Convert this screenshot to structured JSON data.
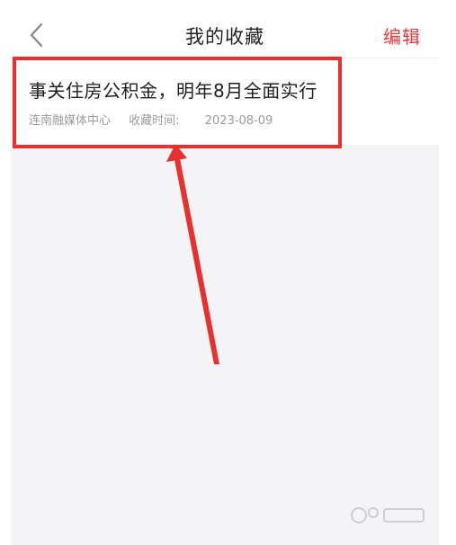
{
  "nav": {
    "title": "我的收藏",
    "edit_label": "编辑",
    "back_icon": "chevron-left-icon"
  },
  "favorites": [
    {
      "title": "事关住房公积金，明年8月全面实行",
      "source": "连南融媒体中心",
      "time_label": "收藏时间:",
      "time_value": "2023-08-09"
    }
  ],
  "annotation": {
    "highlight_color": "#e8302f",
    "arrow_color": "#e8302f"
  },
  "colors": {
    "accent": "#e8373d",
    "background": "#f4f4f6"
  }
}
